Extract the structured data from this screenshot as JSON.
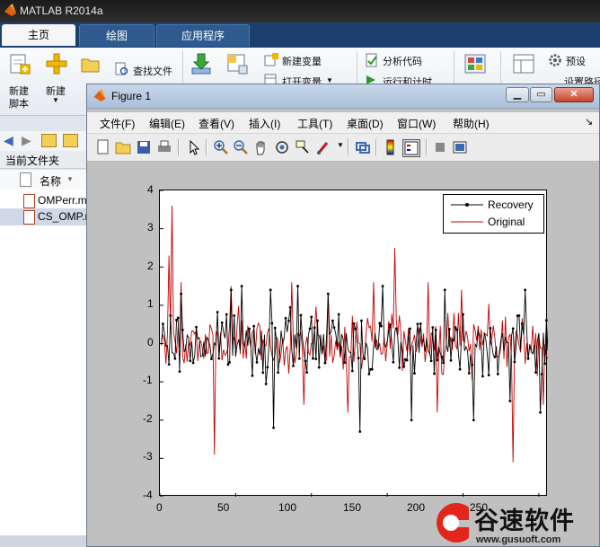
{
  "app": {
    "title": "MATLAB R2014a",
    "tabs": [
      {
        "label": "主页"
      },
      {
        "label": "绘图"
      },
      {
        "label": "应用程序"
      }
    ],
    "ribbon": {
      "new_script": "新建\n脚本",
      "new_script_l1": "新建",
      "new_script_l2": "脚本",
      "new": "新建",
      "find_files": "查找文件",
      "new_variable": "新建变量",
      "open_variable": "打开变量",
      "analyze_code": "分析代码",
      "run_and_time": "运行和计时",
      "preferences": "预设",
      "set_path": "设置路径"
    },
    "left_panel": {
      "header": "当前文件夹",
      "column_name": "名称",
      "files": [
        {
          "name": "OMPerr.m",
          "selected": false
        },
        {
          "name": "CS_OMP.m",
          "selected": true
        }
      ]
    }
  },
  "figure": {
    "title": "Figure 1",
    "menu": [
      "文件(F)",
      "编辑(E)",
      "查看(V)",
      "插入(I)",
      "工具(T)",
      "桌面(D)",
      "窗口(W)",
      "帮助(H)"
    ],
    "toolbar_icons": [
      "new-file-icon",
      "open-folder-icon",
      "save-icon",
      "print-icon",
      "arrow-icon",
      "zoom-in-icon",
      "zoom-out-icon",
      "pan-hand-icon",
      "rotate-icon",
      "data-cursor-icon",
      "brush-icon",
      "link-icon",
      "colorbar-icon",
      "legend-icon",
      "hide-plot-tools-icon",
      "show-plot-tools-icon"
    ]
  },
  "chart_data": {
    "type": "line",
    "title": "",
    "xlabel": "",
    "ylabel": "",
    "xlim": [
      0,
      256
    ],
    "ylim": [
      -4,
      4
    ],
    "xticks": [
      "0",
      "50",
      "100",
      "150",
      "200",
      "250"
    ],
    "yticks": [
      "4",
      "3",
      "2",
      "1",
      "0",
      "-1",
      "-2",
      "-3",
      "-4"
    ],
    "legend_position": "top-right",
    "series": [
      {
        "name": "Recovery",
        "color": "#000000",
        "marker": "dot",
        "n": 256,
        "peaks": [
          [
            13,
            1.3
          ],
          [
            46,
            1.4
          ],
          [
            53,
            1.5
          ],
          [
            72,
            1.4
          ],
          [
            90,
            1.5
          ],
          [
            110,
            1.3
          ],
          [
            146,
            1.5
          ],
          [
            187,
            1.4
          ],
          [
            240,
            1.4
          ],
          [
            74,
            -2.2
          ],
          [
            131,
            -2.3
          ],
          [
            165,
            -2.0
          ],
          [
            206,
            -2.0
          ],
          [
            230,
            -1.5
          ],
          [
            250,
            -1.8
          ]
        ]
      },
      {
        "name": "Original",
        "color": "#c00000",
        "marker": "none",
        "n": 256,
        "peaks": [
          [
            7,
            3.6
          ],
          [
            5,
            2.3
          ],
          [
            13,
            1.6
          ],
          [
            35,
            -2.9
          ],
          [
            46,
            1.5
          ],
          [
            86,
            1.6
          ],
          [
            94,
            -1.6
          ],
          [
            110,
            1.3
          ],
          [
            123,
            -1.8
          ],
          [
            140,
            1.6
          ],
          [
            154,
            2.5
          ],
          [
            176,
            1.6
          ],
          [
            182,
            -1.8
          ],
          [
            198,
            1.4
          ],
          [
            232,
            -3.1
          ],
          [
            252,
            -1.6
          ]
        ]
      }
    ]
  },
  "watermark": {
    "text": "谷速软件",
    "url": "www.gusuoft.com"
  }
}
